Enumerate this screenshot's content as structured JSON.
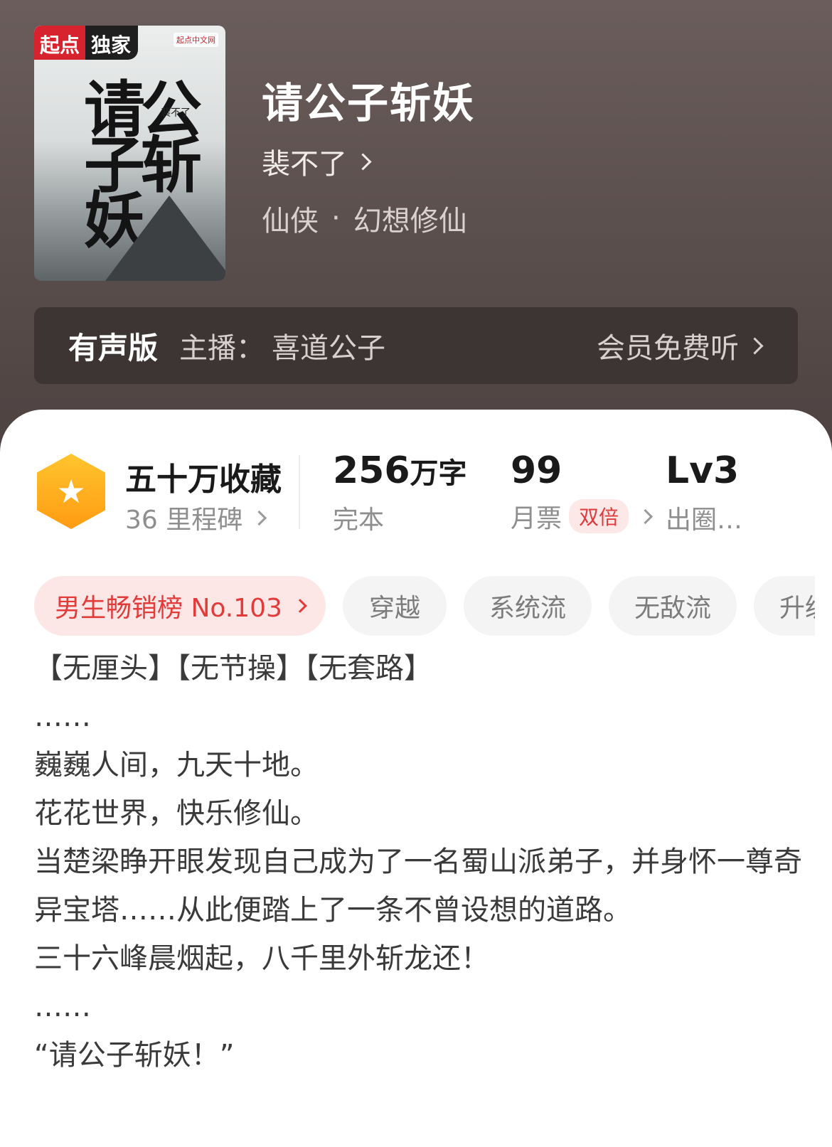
{
  "book": {
    "title": "请公子斩妖",
    "author": "裴不了",
    "genre": "仙侠",
    "genre_sep": "·",
    "subgenre": "幻想修仙",
    "cover": {
      "badge_part1": "起点",
      "badge_part2": "独家",
      "publisher_logo": "起点中文网",
      "cover_title": "请公子斩妖",
      "cover_author": "裴不了"
    }
  },
  "audio": {
    "label": "有声版",
    "narrator_label": "主播：",
    "narrator": "喜道公子",
    "free_listen": "会员免费听"
  },
  "stats": {
    "collect_title": "五十万收藏",
    "milestones": "36 里程碑",
    "word_count_num": "256",
    "word_count_unit": "万字",
    "status": "完本",
    "monthly_votes": "99",
    "monthly_votes_label": "月票",
    "double_badge": "双倍",
    "level": "Lv3",
    "level_label": "出圈…"
  },
  "tags": {
    "rank": "男生畅销榜 No.103",
    "items": [
      "穿越",
      "系统流",
      "无敌流",
      "升级"
    ]
  },
  "description": [
    "【无厘头】【无节操】【无套路】",
    "……",
    "巍巍人间，九天十地。",
    "花花世界，快乐修仙。",
    "当楚梁睁开眼发现自己成为了一名蜀山派弟子，并身怀一尊奇异宝塔……从此便踏上了一条不曾设想的道路。",
    "三十六峰晨烟起，八千里外斩龙还！",
    "……",
    "“请公子斩妖！”"
  ],
  "icons": {
    "collect": "star-hexagon-icon",
    "chevron": "chevron-right-icon"
  },
  "colors": {
    "header_bg": "#5a4e4c",
    "accent_red": "#e13b3a",
    "badge_orange": "#ffa51c"
  }
}
